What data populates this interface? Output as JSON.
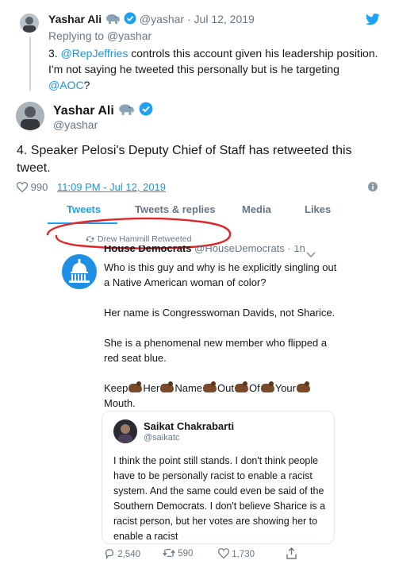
{
  "reply_tweet": {
    "author_name": "Yashar Ali",
    "author_handle": "@yashar",
    "date": "· Jul 12, 2019",
    "replying_to": "Replying to @yashar",
    "text_prefix": "3.",
    "mention_1": "@RepJeffries",
    "text_mid": " controls this account given his leadership position. I'm not saying he tweeted this personally but is he targeting",
    "mention_2": "@AOC",
    "text_suffix": "?"
  },
  "main_tweet": {
    "author_name": "Yashar Ali",
    "author_handle": "@yashar",
    "text": "4. Speaker Pelosi's Deputy Chief of Staff has retweeted this tweet.",
    "likes": "990",
    "timestamp": "11:09 PM - Jul 12, 2019"
  },
  "tabs": [
    {
      "label": "Tweets",
      "active": true
    },
    {
      "label": "Tweets & replies",
      "active": false
    },
    {
      "label": "Media",
      "active": false
    },
    {
      "label": "Likes",
      "active": false
    }
  ],
  "embedded": {
    "retweet_label": "Drew Hammill Retweeted",
    "author_name": "House Democrats",
    "author_handle": "@HouseDemocrats · 1h",
    "para_1": "Who is this guy and why is he explicitly singling out a Native American woman of color?",
    "para_2": "Her name is Congresswoman Davids, not Sharice.",
    "para_3": "She is a phenomenal new member who flipped a red seat blue.",
    "clap_words": [
      "Keep",
      "Her",
      "Name",
      "Out",
      "Of",
      "Your",
      "Mouth."
    ],
    "quote": {
      "author_name": "Saikat Chakrabarti",
      "author_handle": "@saikatc",
      "text": "I think the point still stands. I don't think people have to be personally racist to enable a racist system. And the same could even be said of the Southern Democrats. I don't believe Sharice is a racist person, but her votes are showing her to enable a racist"
    },
    "replies": "2,540",
    "retweets": "590",
    "likes": "1,730"
  },
  "colors": {
    "twitter_blue": "#1da1f2",
    "link_blue": "#1b95e0",
    "muted_gray": "#657786",
    "annotation_red": "#e0252b"
  },
  "icons": [
    "twitter-bird-icon",
    "verified-icon",
    "elephant-icon",
    "heart-icon",
    "info-icon",
    "retweet-icon",
    "reply-icon",
    "share-icon",
    "chevron-down-icon",
    "capitol-icon"
  ]
}
